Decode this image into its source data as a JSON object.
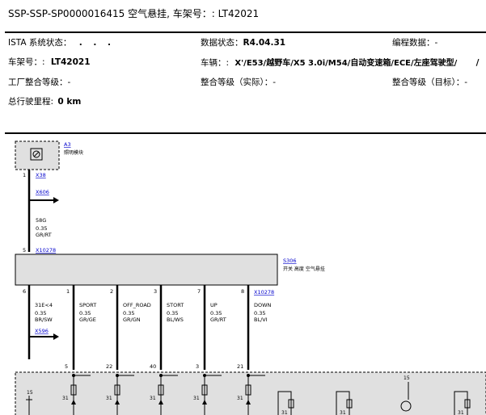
{
  "header": {
    "title": "SSP-SSP-SP0000016415 空气悬挂, 车架号：: LT42021"
  },
  "info": {
    "ista_label": "ISTA 系统状态：",
    "ista_value": ". . .",
    "data_status_label": "数据状态：",
    "data_status_value": "R4.04.31",
    "programming_label": "编程数据：",
    "programming_value": "-",
    "vin_label": "车架号：:",
    "vin_value": "LT42021",
    "vehicle_label": "车辆：:",
    "vehicle_value": "X'/E53/越野车/X5 3.0i/M54/自动变速箱/ECE/左座驾驶型/",
    "vehicle_tail": "/",
    "factory_level_label": "工厂整合等级：",
    "factory_level_value": "-",
    "actual_level_label": "整合等级（实际）：",
    "actual_level_value": "-",
    "target_level_label": "整合等级（目标）：",
    "target_level_value": "-",
    "mileage_label": "总行驶里程:",
    "mileage_value": "0 km"
  },
  "schematic": {
    "module_a3": {
      "id": "A3",
      "name": "照明模块"
    },
    "connector_x38": "X38",
    "pin_1": "1",
    "connector_x606": "X606",
    "wire_58g": {
      "name": "58G",
      "size": "0.35",
      "color": "GR/RT"
    },
    "pin_5_top": "5",
    "connector_x10278_top": "X10278",
    "switch_s306": {
      "id": "S306",
      "name": "开关 高度 空气悬挂"
    },
    "outputs": [
      {
        "pin": "6",
        "name": "31E<4",
        "size": "0.35",
        "color": "BR/SW",
        "bottom": ""
      },
      {
        "pin": "1",
        "name": "SPORT",
        "size": "0.35",
        "color": "GR/GE",
        "bottom": "5"
      },
      {
        "pin": "2",
        "name": "OFF_ROAD",
        "size": "0.35",
        "color": "GR/GN",
        "bottom": "22"
      },
      {
        "pin": "3",
        "name": "STORT",
        "size": "0.35",
        "color": "BL/WS",
        "bottom": "40"
      },
      {
        "pin": "7",
        "name": "UP",
        "size": "0.35",
        "color": "GR/RT",
        "bottom": "3"
      },
      {
        "pin": "8",
        "name": "DOWN",
        "size": "0.35",
        "color": "BL/VI",
        "bottom": "21"
      }
    ],
    "connector_x10278_right": "X10278",
    "connector_x596": "X596",
    "lower_pin_15": "15",
    "lower_pin_31": "31"
  }
}
